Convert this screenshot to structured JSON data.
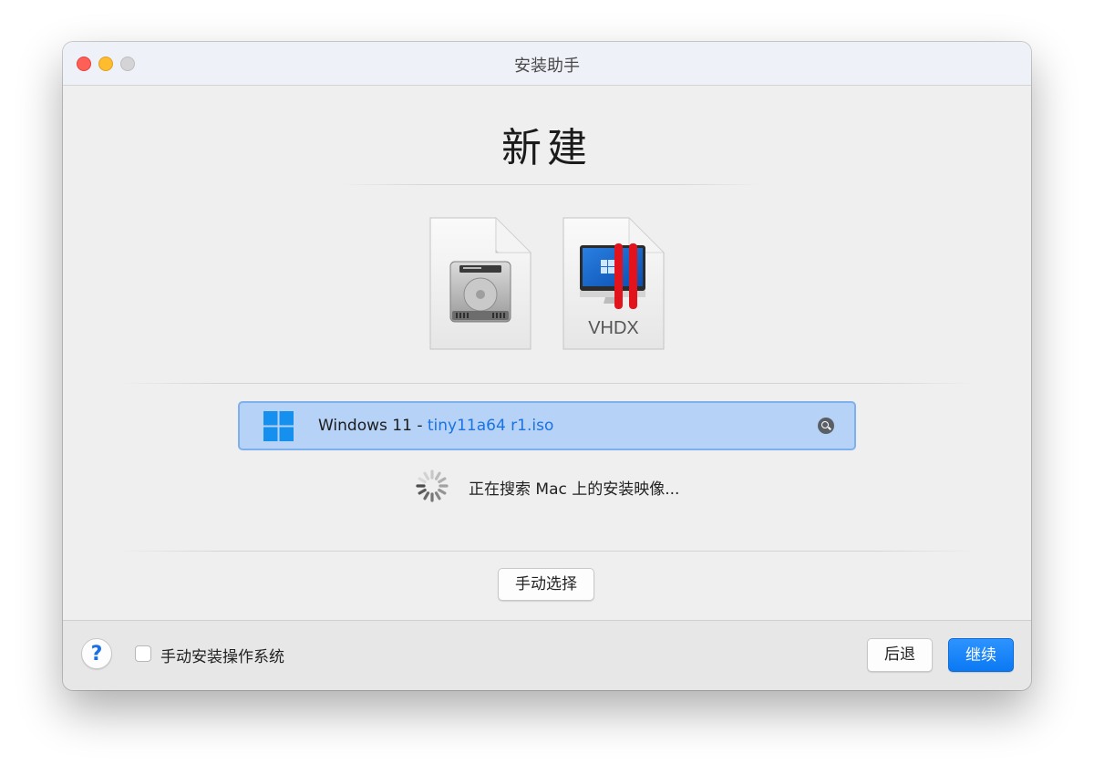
{
  "window": {
    "title": "安装助手"
  },
  "main": {
    "heading": "新建",
    "vhdx_label": "VHDX",
    "source": {
      "os_name": "Windows 11",
      "separator": " - ",
      "file_name": "tiny11a64 r1.iso"
    },
    "status_text": "正在搜索 Mac 上的安装映像...",
    "manual_select_label": "手动选择"
  },
  "footer": {
    "help_label": "?",
    "checkbox_label": "手动安装操作系统",
    "back_label": "后退",
    "continue_label": "继续"
  },
  "colors": {
    "accent": "#0b79f3",
    "selection_bg": "#b6d2f6",
    "file_link": "#1a73e0"
  },
  "icons": [
    "hard-disk-image-icon",
    "vhdx-file-icon",
    "windows-logo-icon",
    "search-icon",
    "spinner-icon",
    "help-icon"
  ]
}
